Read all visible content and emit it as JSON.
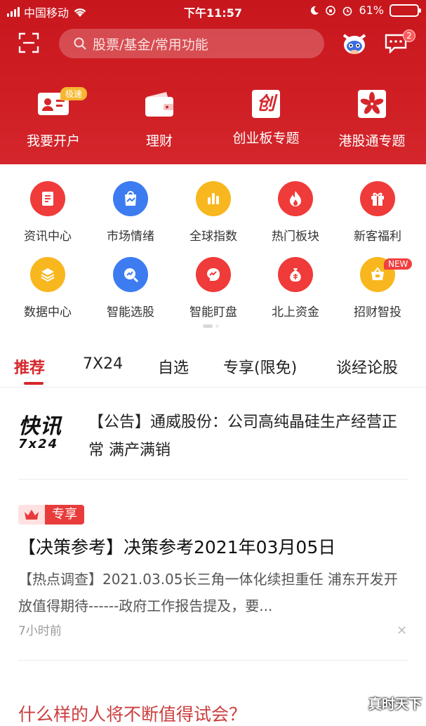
{
  "status_bar": {
    "carrier": "中国移动",
    "time": "下午11:57",
    "battery": "61%",
    "battery_level": 0.61
  },
  "header": {
    "search_placeholder": "股票/基金/常用功能",
    "message_badge": "2"
  },
  "quick_actions": [
    {
      "label": "我要开户",
      "tag": "极速",
      "icon": "id-card-icon"
    },
    {
      "label": "理财",
      "icon": "wallet-icon"
    },
    {
      "label": "创业板专题",
      "glyph": "创",
      "icon": "chinext-icon"
    },
    {
      "label": "港股通专题",
      "icon": "hk-flower-icon"
    }
  ],
  "grid": [
    {
      "label": "资讯中心",
      "icon": "document-icon",
      "color": "#ef3b3a"
    },
    {
      "label": "市场情绪",
      "icon": "market-mood-icon",
      "color": "#3d7cf0"
    },
    {
      "label": "全球指数",
      "icon": "bar-chart-icon",
      "color": "#f8b71e"
    },
    {
      "label": "热门板块",
      "icon": "flame-icon",
      "color": "#ef3b3a"
    },
    {
      "label": "新客福利",
      "icon": "gift-icon",
      "color": "#ef3b3a"
    },
    {
      "label": "数据中心",
      "icon": "layers-icon",
      "color": "#f8b71e"
    },
    {
      "label": "智能选股",
      "icon": "search-chart-icon",
      "color": "#3d7cf0"
    },
    {
      "label": "智能盯盘",
      "icon": "brain-icon",
      "color": "#ef3b3a"
    },
    {
      "label": "北上资金",
      "icon": "money-bag-icon",
      "color": "#ef3b3a"
    },
    {
      "label": "招财智投",
      "icon": "basket-icon",
      "color": "#f8b71e",
      "badge": "NEW"
    }
  ],
  "tabs": [
    {
      "label": "推荐",
      "active": true
    },
    {
      "label": "7X24"
    },
    {
      "label": "自选"
    },
    {
      "label": "专享(限免)"
    },
    {
      "label": "谈经论股"
    }
  ],
  "feed": {
    "flash": {
      "logo_top": "快讯",
      "logo_bottom": "7x24",
      "text": "【公告】通威股份：公司高纯晶硅生产经营正常 满产满销"
    },
    "article": {
      "tag": "专享",
      "title": "【决策参考】决策参考2021年03月05日",
      "summary": "【热点调查】2021.03.05长三角一体化续担重任 浦东开发开放值得期待------政府工作报告提及，要...",
      "time": "7小时前"
    },
    "next_title": "什么样的人将不断值得试会？"
  },
  "watermark": "真时天下"
}
